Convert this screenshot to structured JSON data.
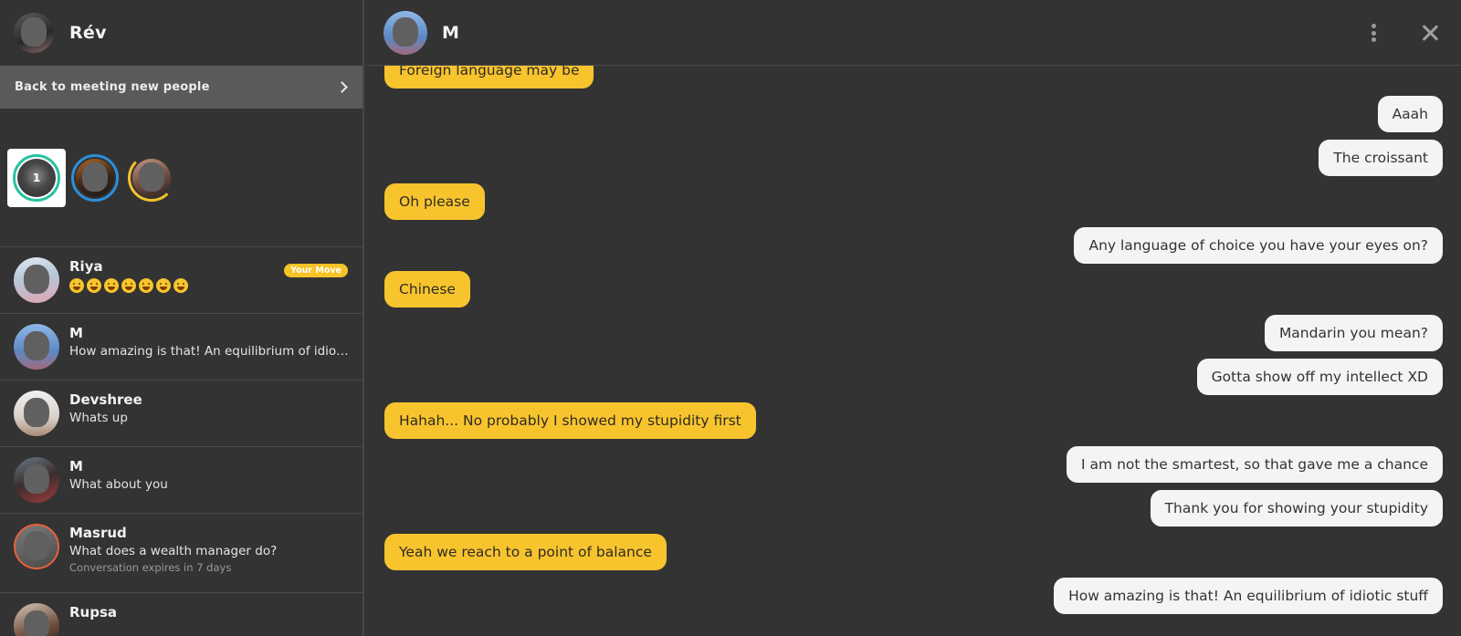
{
  "profile": {
    "name": "Rév"
  },
  "back_bar": {
    "label": "Back to meeting new people"
  },
  "stories": {
    "count_badge": "1"
  },
  "conversations": [
    {
      "name": "Riya",
      "preview": "",
      "emoji_count": 7,
      "badge": "Your Move",
      "expiry": ""
    },
    {
      "name": "M",
      "preview": "How amazing is that! An equilibrium of idiotic stuff",
      "badge": "",
      "expiry": ""
    },
    {
      "name": "Devshree",
      "preview": "Whats up",
      "badge": "",
      "expiry": ""
    },
    {
      "name": "M",
      "preview": "What about you",
      "badge": "",
      "expiry": ""
    },
    {
      "name": "Masrud",
      "preview": "What does a wealth manager do?",
      "badge": "",
      "expiry": "Conversation expires in 7 days"
    },
    {
      "name": "Rupsa",
      "preview": "",
      "badge": "",
      "expiry": ""
    }
  ],
  "chat": {
    "title": "M",
    "messages": [
      {
        "side": "in",
        "text": "Foreign language may be"
      },
      {
        "side": "out",
        "text": "Aaah"
      },
      {
        "side": "out",
        "text": "The croissant"
      },
      {
        "side": "in",
        "text": "Oh please"
      },
      {
        "side": "out",
        "text": "Any language of choice you have your eyes on?"
      },
      {
        "side": "in",
        "text": "Chinese"
      },
      {
        "side": "out",
        "text": "Mandarin you mean?"
      },
      {
        "side": "out",
        "text": "Gotta show off my intellect XD"
      },
      {
        "side": "in",
        "text": "Hahah... No probably I showed my stupidity first"
      },
      {
        "side": "out",
        "text": "I am not the smartest, so that gave me a chance"
      },
      {
        "side": "out",
        "text": "Thank you for showing your stupidity"
      },
      {
        "side": "in",
        "text": "Yeah we reach to a point of balance"
      },
      {
        "side": "out",
        "text": "How amazing is that! An equilibrium of idiotic stuff"
      }
    ]
  },
  "colors": {
    "background": "#333333",
    "incoming_bubble": "#f8c42e",
    "outgoing_bubble": "#f4f4f4",
    "your_move_badge": "#f7c326",
    "story_ring_green": "#27c2a1",
    "story_ring_blue": "#2e8fd8",
    "expiry_ring": "#e8613a"
  }
}
